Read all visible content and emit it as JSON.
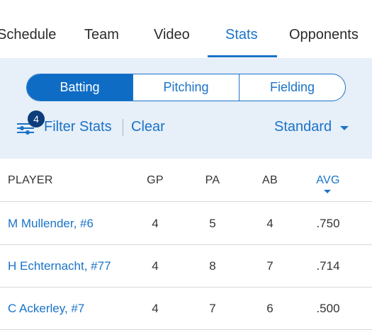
{
  "tabs": [
    {
      "label": "Schedule"
    },
    {
      "label": "Team"
    },
    {
      "label": "Video"
    },
    {
      "label": "Stats"
    },
    {
      "label": "Opponents"
    }
  ],
  "segments": [
    {
      "label": "Batting"
    },
    {
      "label": "Pitching"
    },
    {
      "label": "Fielding"
    }
  ],
  "filter": {
    "badge_count": "4",
    "label": "Filter Stats",
    "clear_label": "Clear",
    "view_selected": "Standard"
  },
  "table": {
    "headers": [
      "PLAYER",
      "GP",
      "PA",
      "AB",
      "AVG"
    ],
    "sorted_by": "AVG",
    "rows": [
      {
        "player": "M Mullender, #6",
        "gp": "4",
        "pa": "5",
        "ab": "4",
        "avg": ".750"
      },
      {
        "player": "H Echternacht, #77",
        "gp": "4",
        "pa": "8",
        "ab": "7",
        "avg": ".714"
      },
      {
        "player": "C Ackerley, #7",
        "gp": "4",
        "pa": "7",
        "ab": "6",
        "avg": ".500"
      }
    ]
  },
  "colors": {
    "accent": "#1a73c8",
    "segment_active": "#0f6cc4",
    "badge": "#0d3d7a",
    "panel_bg": "#e7eff8"
  }
}
